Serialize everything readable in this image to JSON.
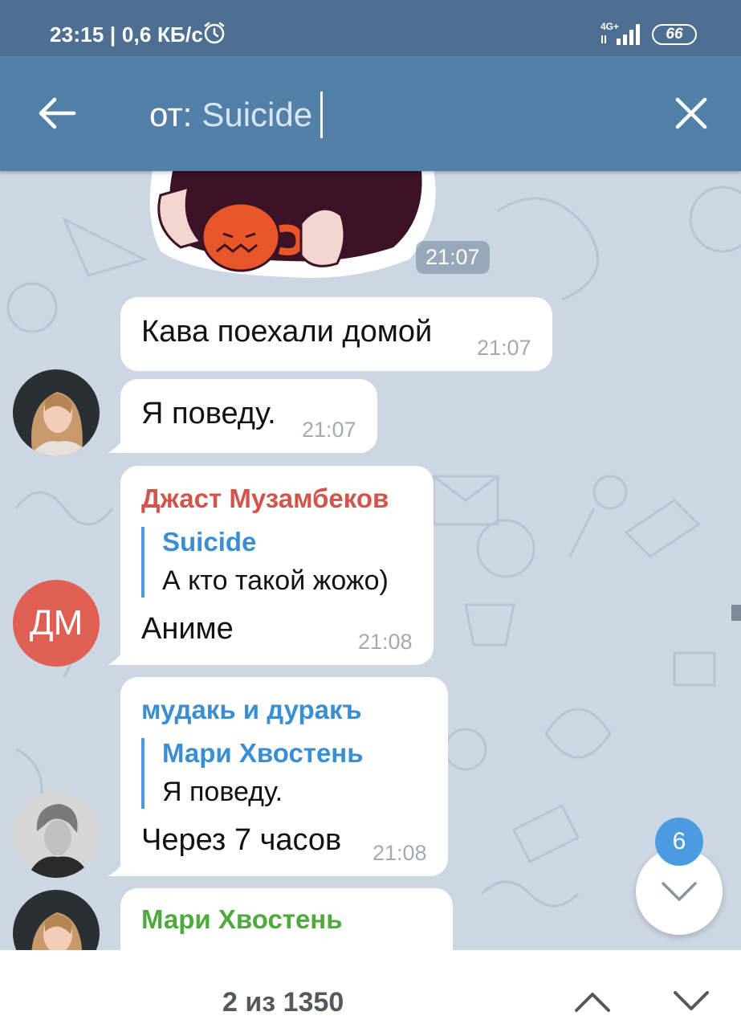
{
  "status_bar": {
    "time_speed": "23:15 | 0,6 КБ/с",
    "network": "4G+",
    "battery": "66"
  },
  "search": {
    "prefix": "от:",
    "query": "Suicide"
  },
  "messages": [
    {
      "type": "sticker",
      "time": "21:07"
    },
    {
      "type": "text",
      "text": "Кава поехали домой",
      "time": "21:07"
    },
    {
      "type": "text",
      "text": "Я поведу.",
      "time": "21:07"
    },
    {
      "type": "reply",
      "sender": "Джаст Музамбеков",
      "sender_color": "#d2544a",
      "avatar_initials": "ДМ",
      "reply_name": "Suicide",
      "reply_text": "А кто такой жожо)",
      "text": "Аниме",
      "time": "21:08"
    },
    {
      "type": "reply",
      "sender": "мудакь и дуракъ",
      "sender_color": "#3a8fd2",
      "reply_name": "Мари Хвостень",
      "reply_text": "Я поведу.",
      "text": "Через 7 часов",
      "time": "21:08"
    },
    {
      "type": "partial",
      "sender": "Мари Хвостень",
      "sender_color": "#4faa3e"
    }
  ],
  "unread_badge": "6",
  "results": {
    "counter": "2 из 1350"
  },
  "colors": {
    "status_bar": "#4d6f92",
    "header": "#5280a8",
    "chat_bg": "#cbd7e3",
    "accent_blue": "#3a8fd2",
    "badge": "#4a9be0"
  },
  "icons": [
    "back-arrow-icon",
    "close-icon",
    "alarm-icon",
    "signal-icon",
    "battery-icon",
    "chevron-down-icon",
    "chevron-up-icon"
  ]
}
